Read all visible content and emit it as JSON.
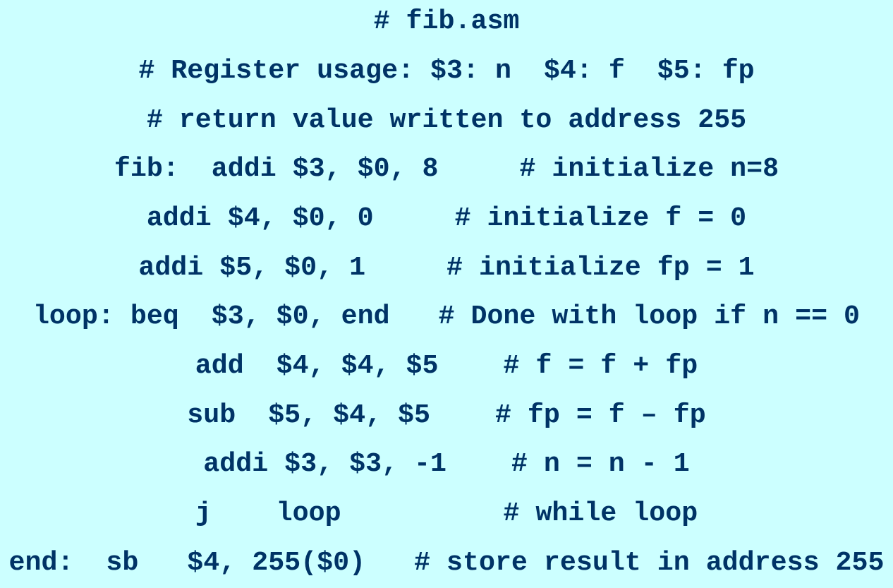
{
  "document": {
    "title": "# fib.asm",
    "lines": [
      "# Register usage: $3: n  $4: f  $5: fp",
      "# return value written to address 255",
      "fib:  addi $3, $0, 8     # initialize n=8",
      "addi $4, $0, 0     # initialize f = 0",
      "addi $5, $0, 1     # initialize fp = 1",
      "loop: beq  $3, $0, end   # Done with loop if n == 0",
      "add  $4, $4, $5    # f = f + fp",
      "sub  $5, $4, $5    # fp = f – fp",
      "addi $3, $3, -1    # n = n - 1",
      "j    loop          # while loop",
      "end:  sb   $4, 255($0)   # store result in address 255"
    ]
  },
  "colors": {
    "background": "#ccffff",
    "text": "#003366"
  }
}
